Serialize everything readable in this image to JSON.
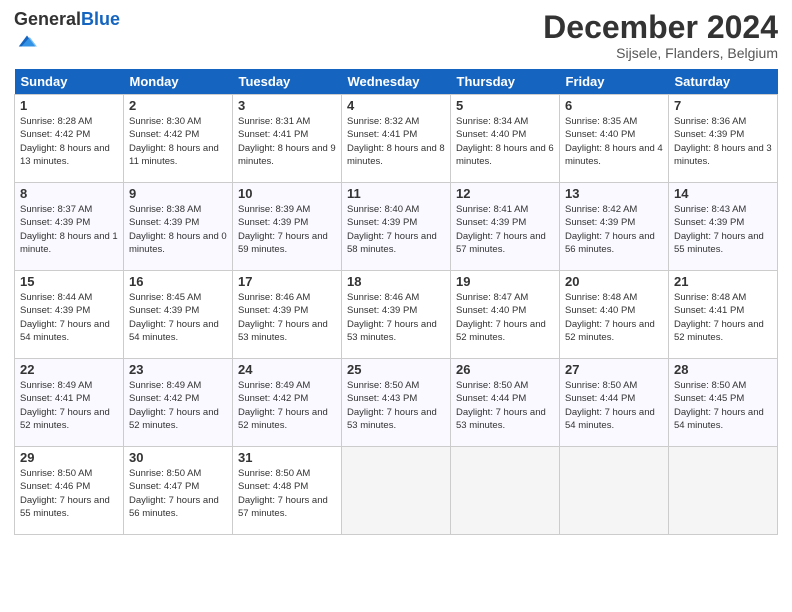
{
  "header": {
    "logo_general": "General",
    "logo_blue": "Blue",
    "month_title": "December 2024",
    "location": "Sijsele, Flanders, Belgium"
  },
  "weekdays": [
    "Sunday",
    "Monday",
    "Tuesday",
    "Wednesday",
    "Thursday",
    "Friday",
    "Saturday"
  ],
  "weeks": [
    [
      {
        "day": "1",
        "sunrise": "Sunrise: 8:28 AM",
        "sunset": "Sunset: 4:42 PM",
        "daylight": "Daylight: 8 hours and 13 minutes."
      },
      {
        "day": "2",
        "sunrise": "Sunrise: 8:30 AM",
        "sunset": "Sunset: 4:42 PM",
        "daylight": "Daylight: 8 hours and 11 minutes."
      },
      {
        "day": "3",
        "sunrise": "Sunrise: 8:31 AM",
        "sunset": "Sunset: 4:41 PM",
        "daylight": "Daylight: 8 hours and 9 minutes."
      },
      {
        "day": "4",
        "sunrise": "Sunrise: 8:32 AM",
        "sunset": "Sunset: 4:41 PM",
        "daylight": "Daylight: 8 hours and 8 minutes."
      },
      {
        "day": "5",
        "sunrise": "Sunrise: 8:34 AM",
        "sunset": "Sunset: 4:40 PM",
        "daylight": "Daylight: 8 hours and 6 minutes."
      },
      {
        "day": "6",
        "sunrise": "Sunrise: 8:35 AM",
        "sunset": "Sunset: 4:40 PM",
        "daylight": "Daylight: 8 hours and 4 minutes."
      },
      {
        "day": "7",
        "sunrise": "Sunrise: 8:36 AM",
        "sunset": "Sunset: 4:39 PM",
        "daylight": "Daylight: 8 hours and 3 minutes."
      }
    ],
    [
      {
        "day": "8",
        "sunrise": "Sunrise: 8:37 AM",
        "sunset": "Sunset: 4:39 PM",
        "daylight": "Daylight: 8 hours and 1 minute."
      },
      {
        "day": "9",
        "sunrise": "Sunrise: 8:38 AM",
        "sunset": "Sunset: 4:39 PM",
        "daylight": "Daylight: 8 hours and 0 minutes."
      },
      {
        "day": "10",
        "sunrise": "Sunrise: 8:39 AM",
        "sunset": "Sunset: 4:39 PM",
        "daylight": "Daylight: 7 hours and 59 minutes."
      },
      {
        "day": "11",
        "sunrise": "Sunrise: 8:40 AM",
        "sunset": "Sunset: 4:39 PM",
        "daylight": "Daylight: 7 hours and 58 minutes."
      },
      {
        "day": "12",
        "sunrise": "Sunrise: 8:41 AM",
        "sunset": "Sunset: 4:39 PM",
        "daylight": "Daylight: 7 hours and 57 minutes."
      },
      {
        "day": "13",
        "sunrise": "Sunrise: 8:42 AM",
        "sunset": "Sunset: 4:39 PM",
        "daylight": "Daylight: 7 hours and 56 minutes."
      },
      {
        "day": "14",
        "sunrise": "Sunrise: 8:43 AM",
        "sunset": "Sunset: 4:39 PM",
        "daylight": "Daylight: 7 hours and 55 minutes."
      }
    ],
    [
      {
        "day": "15",
        "sunrise": "Sunrise: 8:44 AM",
        "sunset": "Sunset: 4:39 PM",
        "daylight": "Daylight: 7 hours and 54 minutes."
      },
      {
        "day": "16",
        "sunrise": "Sunrise: 8:45 AM",
        "sunset": "Sunset: 4:39 PM",
        "daylight": "Daylight: 7 hours and 54 minutes."
      },
      {
        "day": "17",
        "sunrise": "Sunrise: 8:46 AM",
        "sunset": "Sunset: 4:39 PM",
        "daylight": "Daylight: 7 hours and 53 minutes."
      },
      {
        "day": "18",
        "sunrise": "Sunrise: 8:46 AM",
        "sunset": "Sunset: 4:39 PM",
        "daylight": "Daylight: 7 hours and 53 minutes."
      },
      {
        "day": "19",
        "sunrise": "Sunrise: 8:47 AM",
        "sunset": "Sunset: 4:40 PM",
        "daylight": "Daylight: 7 hours and 52 minutes."
      },
      {
        "day": "20",
        "sunrise": "Sunrise: 8:48 AM",
        "sunset": "Sunset: 4:40 PM",
        "daylight": "Daylight: 7 hours and 52 minutes."
      },
      {
        "day": "21",
        "sunrise": "Sunrise: 8:48 AM",
        "sunset": "Sunset: 4:41 PM",
        "daylight": "Daylight: 7 hours and 52 minutes."
      }
    ],
    [
      {
        "day": "22",
        "sunrise": "Sunrise: 8:49 AM",
        "sunset": "Sunset: 4:41 PM",
        "daylight": "Daylight: 7 hours and 52 minutes."
      },
      {
        "day": "23",
        "sunrise": "Sunrise: 8:49 AM",
        "sunset": "Sunset: 4:42 PM",
        "daylight": "Daylight: 7 hours and 52 minutes."
      },
      {
        "day": "24",
        "sunrise": "Sunrise: 8:49 AM",
        "sunset": "Sunset: 4:42 PM",
        "daylight": "Daylight: 7 hours and 52 minutes."
      },
      {
        "day": "25",
        "sunrise": "Sunrise: 8:50 AM",
        "sunset": "Sunset: 4:43 PM",
        "daylight": "Daylight: 7 hours and 53 minutes."
      },
      {
        "day": "26",
        "sunrise": "Sunrise: 8:50 AM",
        "sunset": "Sunset: 4:44 PM",
        "daylight": "Daylight: 7 hours and 53 minutes."
      },
      {
        "day": "27",
        "sunrise": "Sunrise: 8:50 AM",
        "sunset": "Sunset: 4:44 PM",
        "daylight": "Daylight: 7 hours and 54 minutes."
      },
      {
        "day": "28",
        "sunrise": "Sunrise: 8:50 AM",
        "sunset": "Sunset: 4:45 PM",
        "daylight": "Daylight: 7 hours and 54 minutes."
      }
    ],
    [
      {
        "day": "29",
        "sunrise": "Sunrise: 8:50 AM",
        "sunset": "Sunset: 4:46 PM",
        "daylight": "Daylight: 7 hours and 55 minutes."
      },
      {
        "day": "30",
        "sunrise": "Sunrise: 8:50 AM",
        "sunset": "Sunset: 4:47 PM",
        "daylight": "Daylight: 7 hours and 56 minutes."
      },
      {
        "day": "31",
        "sunrise": "Sunrise: 8:50 AM",
        "sunset": "Sunset: 4:48 PM",
        "daylight": "Daylight: 7 hours and 57 minutes."
      },
      null,
      null,
      null,
      null
    ]
  ]
}
